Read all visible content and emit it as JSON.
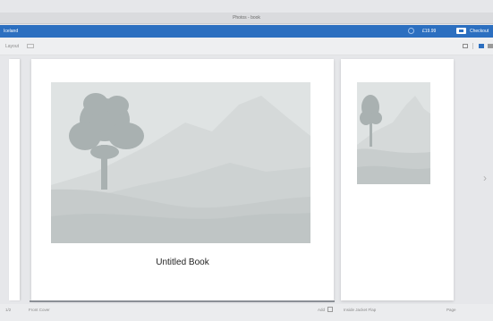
{
  "window": {
    "title": "Photos - book"
  },
  "blue_bar": {
    "project_label": "Iceland",
    "price": "£19.99",
    "checkout_label": "Checkout",
    "accent_color": "#2c6fc0"
  },
  "toolbar": {
    "left_label": "Layout",
    "view_icons": [
      "single-page-view-icon",
      "spread-view-icon",
      "grid-view-icon"
    ]
  },
  "book": {
    "cover_title": "Untitled Book",
    "arrow_glyph": "›"
  },
  "footer": {
    "left_number": "1/2",
    "left_label": "Front Cover",
    "add_label": "Add",
    "page_label": "Inside Jacket Flap",
    "right_label": "Page"
  },
  "placeholder_colors": {
    "sky": "#dfe3e3",
    "far_mountain": "#cfd4d4",
    "near_hill": "#c2c8c8",
    "tree": "#a9b1b1"
  }
}
